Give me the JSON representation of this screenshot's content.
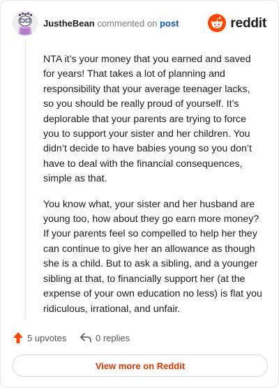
{
  "header": {
    "username": "JustheBean",
    "commented_on": "commented on",
    "post_link": "post",
    "brand_icon": "reddit-alien-icon",
    "brand_word": "reddit",
    "brand_color": "#ff4500"
  },
  "comment": {
    "paragraphs": [
      "NTA it’s your money that you earned and saved for years! That takes a lot of planning and responsibility that your average teenager lacks, so you should be really proud of yourself. It’s deplorable that your parents are trying to force you to support your sister and her children. You didn’t decide to have babies young so you don’t have to deal with the financial consequences, simple as that.",
      "You know what, your sister and her husband are young too, how about they go earn more money? If your parents feel so compelled to help her they can continue to give her an allowance as though she is a child. But to ask a sibling, and a younger sibling at that, to financially support her (at the expense of your own education no less) is flat you ridiculous, irrational, and unfair."
    ]
  },
  "actions": {
    "upvotes_icon": "upvote-arrow-icon",
    "upvotes_label": "5 upvotes",
    "replies_icon": "reply-arrow-icon",
    "replies_label": "0 replies"
  },
  "footer": {
    "view_more_label": "View more on Reddit",
    "accent_color": "#d93a00"
  }
}
